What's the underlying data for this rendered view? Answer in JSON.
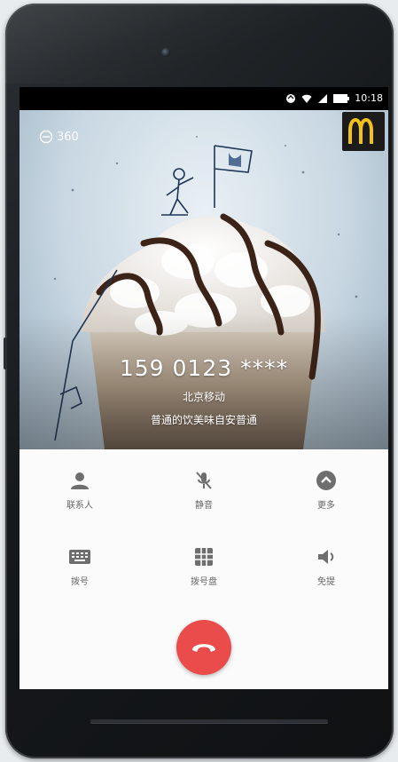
{
  "status_bar": {
    "time": "10:18"
  },
  "caller_tag": {
    "label": "360"
  },
  "call": {
    "number": "159 0123 ****",
    "carrier": "北京移动",
    "ad_text": "普通的饮美味自安普通"
  },
  "controls": [
    {
      "icon": "person-icon",
      "label": "联系人"
    },
    {
      "icon": "mic-off-icon",
      "label": "静音"
    },
    {
      "icon": "chevron-up-icon",
      "label": "更多"
    },
    {
      "icon": "keyboard-icon",
      "label": "拨号"
    },
    {
      "icon": "dialpad-icon",
      "label": "拨号盘"
    },
    {
      "icon": "speaker-icon",
      "label": "免提"
    }
  ],
  "colors": {
    "hangup": "#ea4b4b",
    "icon": "#6e6e6e",
    "brand_yellow": "#f2c21a"
  }
}
